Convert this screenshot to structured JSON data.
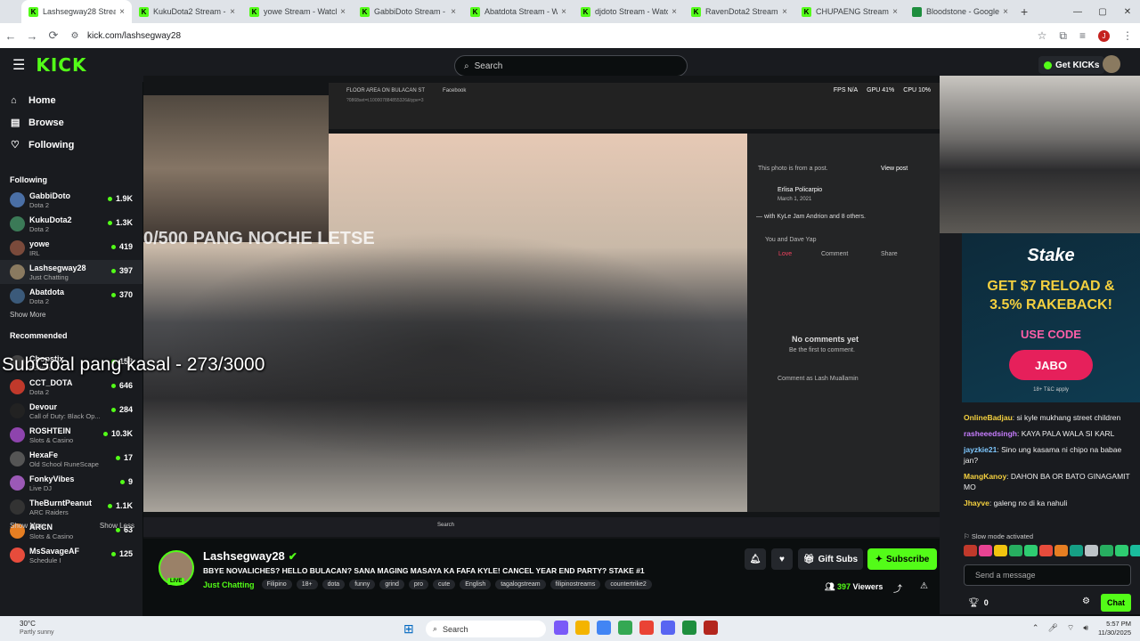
{
  "browser": {
    "tabs": [
      {
        "label": "Lashsegway28 Stream",
        "active": true,
        "icon": "kick"
      },
      {
        "label": "KukuDota2 Stream - Wa",
        "icon": "kick"
      },
      {
        "label": "yowe Stream - Watch L",
        "icon": "kick"
      },
      {
        "label": "GabbiDoto Stream - Wa",
        "icon": "kick"
      },
      {
        "label": "Abatdota Stream - Watc",
        "icon": "kick"
      },
      {
        "label": "djdoto Stream - Watch l",
        "icon": "kick"
      },
      {
        "label": "RavenDota2 Stream - W",
        "icon": "kick"
      },
      {
        "label": "CHUPAENG Stream - Wa",
        "icon": "kick"
      },
      {
        "label": "Bloodstone - Google Sh",
        "icon": "sheets"
      }
    ],
    "url": "kick.com/lashsegway28",
    "profile_initial": "J"
  },
  "topnav": {
    "logo": "KICK",
    "search_placeholder": "Search",
    "get_kicks": "Get KICKs"
  },
  "sidebar": {
    "nav": [
      {
        "label": "Home",
        "icon": "home-icon"
      },
      {
        "label": "Browse",
        "icon": "browse-icon"
      },
      {
        "label": "Following",
        "icon": "heart-icon"
      }
    ],
    "following_title": "Following",
    "following": [
      {
        "name": "GabbiDoto",
        "category": "Dota 2",
        "viewers": "1.9K"
      },
      {
        "name": "KukuDota2",
        "category": "Dota 2",
        "viewers": "1.3K"
      },
      {
        "name": "yowe",
        "category": "IRL",
        "viewers": "419"
      },
      {
        "name": "Lashsegway28",
        "category": "Just Chatting",
        "viewers": "397",
        "selected": true
      },
      {
        "name": "Abatdota",
        "category": "Dota 2",
        "viewers": "370"
      }
    ],
    "show_more": "Show More",
    "recommended_title": "Recommended",
    "recommended": [
      {
        "name": "Chopstix",
        "category": "Fortnite",
        "viewers": "158"
      },
      {
        "name": "CCT_DOTA",
        "category": "Dota 2",
        "viewers": "646"
      },
      {
        "name": "Devour",
        "category": "Call of Duty: Black Op...",
        "viewers": "284"
      },
      {
        "name": "ROSHTEIN",
        "category": "Slots & Casino",
        "viewers": "10.3K"
      },
      {
        "name": "HexaFe",
        "category": "Old School RuneScape",
        "viewers": "17"
      },
      {
        "name": "FonkyVibes",
        "category": "Live DJ",
        "viewers": "9"
      },
      {
        "name": "TheBurntPeanut",
        "category": "ARC Raiders",
        "viewers": "1.1K"
      },
      {
        "name": "ARCN",
        "category": "Slots & Casino",
        "viewers": "63"
      },
      {
        "name": "MsSavageAF",
        "category": "Schedule I",
        "viewers": "125"
      }
    ],
    "show_more_bottom": "Show More",
    "show_less": "Show Less"
  },
  "overlay": {
    "goal": "SubGoal pang kasal - 273/3000",
    "banner": "0/500 PANG NOCHE LETSE"
  },
  "stream_screen": {
    "tabs": [
      "FLOOR AREA ON BULACAN ST",
      "Facebook"
    ],
    "url": "?0868set=t.100007884855326&type=3",
    "fps": "FPS N/A",
    "gpu": "GPU 41%",
    "cpu": "CPU 10%",
    "fb": {
      "from_post": "This photo is from a post.",
      "view_post": "View post",
      "poster": "Erlisa Policarpio",
      "date": "March 1, 2021",
      "with": "— with KyLe Jam Andrion and 8 others.",
      "reactions": "You and Dave Yap",
      "love": "Love",
      "comment": "Comment",
      "share": "Share",
      "no_comments": "No comments yet",
      "be_first": "Be the first to comment.",
      "comment_as": "Comment as Lash Muallamin"
    },
    "taskbar_search": "Search"
  },
  "stream_info": {
    "name": "Lashsegway28",
    "title": "BBYE NOVALICHES? HELLO BULACAN? SANA MAGING MASAYA KA FAFA KYLE! CANCEL YEAR END PARTY? STAKE #1",
    "category": "Just Chatting",
    "tags": [
      "Filipino",
      "18+",
      "dota",
      "funny",
      "grind",
      "pro",
      "cute",
      "English",
      "tagalogstream",
      "filipinostreams",
      "countertrike2"
    ],
    "gift_subs": "Gift Subs",
    "subscribe": "Subscribe",
    "viewers_count": "397",
    "viewers_label": "Viewers",
    "live_badge": "LIVE"
  },
  "ad": {
    "brand": "Stake",
    "line1": "GET $7 RELOAD &",
    "line2": "3.5% RAKEBACK!",
    "use_code": "USE CODE",
    "code": "JABO",
    "tc": "18+ T&C apply"
  },
  "chat": {
    "messages": [
      {
        "user": "OnlineBadjau",
        "color": "#f4d03f",
        "text": "si kyle mukhang street children"
      },
      {
        "user": "rasheeedsingh",
        "color": "#c77dff",
        "text": "KAYA PALA WALA SI KARL"
      },
      {
        "user": "jayzkie21",
        "color": "#7ec8ff",
        "text": "Sino ung kasama ni chipo na babae jan?"
      },
      {
        "user": "MangKanoy",
        "color": "#f4d03f",
        "text": "DAHON BA OR BATO GINAGAMIT MO"
      },
      {
        "user": "Jhayve",
        "color": "#f4d03f",
        "text": "galeng no di ka nahuli"
      }
    ],
    "slow_mode": "Slow mode activated",
    "placeholder": "Send a message",
    "points": "0",
    "chat_button": "Chat"
  },
  "windows": {
    "temp": "30°C",
    "condition": "Partly sunny",
    "search": "Search",
    "time": "5:57 PM",
    "date": "11/30/2025"
  }
}
